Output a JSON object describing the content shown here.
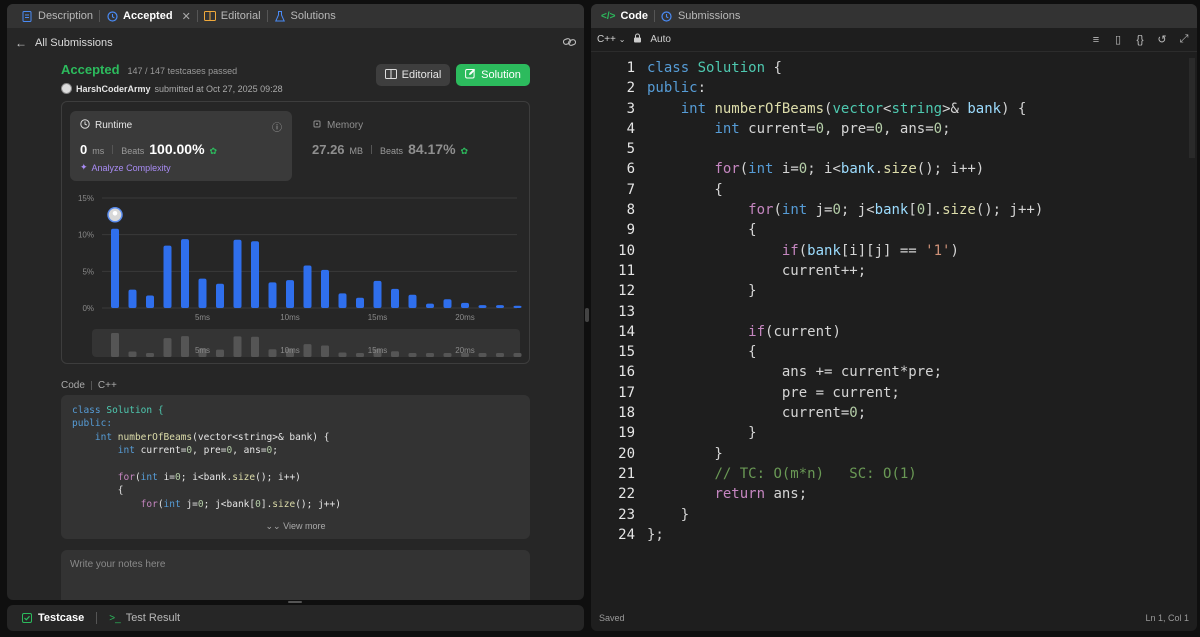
{
  "left_tabs": [
    {
      "label": "Description",
      "icon": "doc-icon"
    },
    {
      "label": "Accepted",
      "icon": "history-icon",
      "close": "✕"
    },
    {
      "label": "Editorial",
      "icon": "book-icon"
    },
    {
      "label": "Solutions",
      "icon": "flask-icon"
    }
  ],
  "subheader": {
    "back_label": "All Submissions"
  },
  "submission": {
    "status": "Accepted",
    "testcases": "147 / 147 testcases passed",
    "user": "HarshCoderArmy",
    "submitted_at": "submitted at Oct 27, 2025 09:28",
    "editorial_button": "Editorial",
    "solution_button": "Solution"
  },
  "runtime": {
    "title": "Runtime",
    "value": "0",
    "unit": "ms",
    "beats_label": "Beats",
    "beats": "100.00%",
    "analyze": "Analyze Complexity"
  },
  "memory": {
    "title": "Memory",
    "value": "27.26",
    "unit": "MB",
    "beats_label": "Beats",
    "beats": "84.17%"
  },
  "chart_data": {
    "type": "bar",
    "ytick_labels": [
      "15%",
      "10%",
      "5%",
      "0%"
    ],
    "yticks": [
      15,
      10,
      5,
      0
    ],
    "ylim": [
      0,
      15
    ],
    "xtick_labels": [
      "5ms",
      "10ms",
      "15ms",
      "20ms"
    ],
    "xtick_positions": [
      5,
      10,
      15,
      20
    ],
    "x": [
      0,
      1,
      2,
      3,
      4,
      5,
      6,
      7,
      8,
      9,
      10,
      11,
      12,
      13,
      14,
      15,
      16,
      17,
      18,
      19,
      20,
      21,
      22,
      23
    ],
    "values": [
      10.8,
      2.5,
      1.7,
      8.5,
      9.4,
      4.0,
      3.3,
      9.3,
      9.1,
      3.5,
      3.8,
      5.8,
      5.2,
      2.0,
      1.4,
      3.7,
      2.6,
      1.8,
      0.6,
      1.2,
      0.7,
      0.4,
      0.4,
      0.3
    ],
    "highlight_index": 0,
    "mini_xtick_labels": [
      "5ms",
      "10ms",
      "15ms",
      "20ms"
    ]
  },
  "code_section": {
    "label": "Code",
    "lang": "C++"
  },
  "code_preview": [
    "class Solution {",
    "public:",
    "    int numberOfBeams(vector<string>& bank) {",
    "        int current=0, pre=0, ans=0;",
    "",
    "        for(int i=0; i<bank.size(); i++)",
    "        {",
    "            for(int j=0; j<bank[0].size(); j++)"
  ],
  "view_more": "View more",
  "notes_placeholder": "Write your notes here",
  "bottom_tabs": [
    {
      "label": "Testcase",
      "icon": "checkbox-icon"
    },
    {
      "label": "Test Result",
      "icon": "terminal-icon"
    }
  ],
  "right_tabs": [
    {
      "label": "Code",
      "icon": "code-icon"
    },
    {
      "label": "Submissions",
      "icon": "history-icon"
    }
  ],
  "toolbar": {
    "language": "C++",
    "autocomplete": "Auto"
  },
  "editor_line_numbers": [
    "1",
    "2",
    "3",
    "4",
    "5",
    "6",
    "7",
    "8",
    "9",
    "10",
    "11",
    "12",
    "13",
    "14",
    "15",
    "16",
    "17",
    "18",
    "19",
    "20",
    "21",
    "22",
    "23",
    "24"
  ],
  "status": {
    "left": "Saved",
    "right": "Ln 1, Col 1"
  },
  "colors": {
    "accent_green": "#2cbb5d",
    "bar_blue": "#2f6fed",
    "analyze_purple": "#a98cf5"
  }
}
